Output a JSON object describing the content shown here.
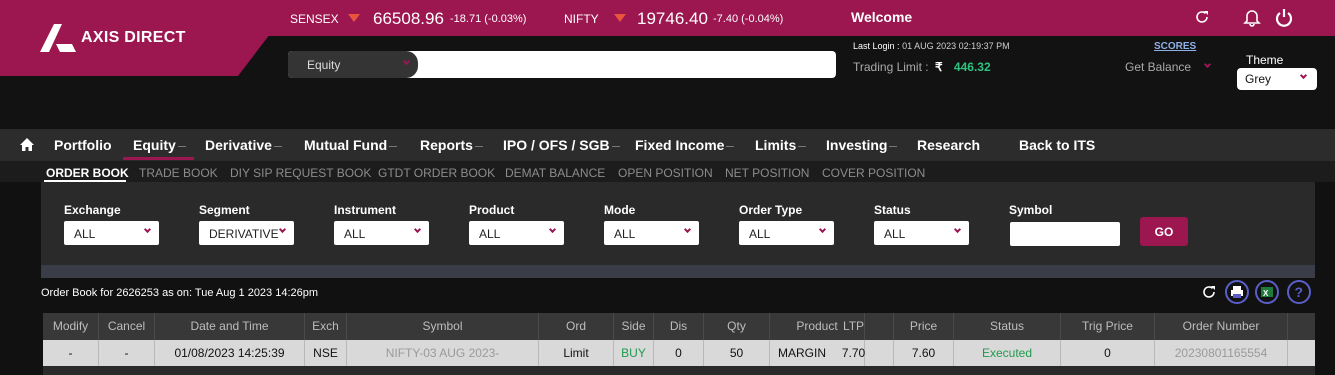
{
  "brand": {
    "name": "AXIS DIRECT",
    "color": "#9c1650"
  },
  "ticker": {
    "sensex": {
      "name": "SENSEX",
      "value": "66508.96",
      "change": "-18.71 (-0.03%)",
      "direction": "down"
    },
    "nifty": {
      "name": "NIFTY",
      "value": "19746.40",
      "change": "-7.40 (-0.04%)",
      "direction": "down"
    }
  },
  "welcome": {
    "title": "Welcome"
  },
  "search": {
    "segment": "Equity",
    "placeholder": ""
  },
  "account": {
    "last_login_label": "Last Login :",
    "last_login_value": "01 AUG 2023 02:19:37 PM",
    "trading_limit_label": "Trading Limit :",
    "currency_symbol": "₹",
    "trading_limit_value": "446.32",
    "scores_label": "SCORES",
    "get_balance_label": "Get Balance",
    "theme_label": "Theme",
    "theme_value": "Grey"
  },
  "nav": {
    "items": [
      {
        "label": "Portfolio",
        "dropdown": false
      },
      {
        "label": "Equity",
        "dropdown": true,
        "active": true
      },
      {
        "label": "Derivative",
        "dropdown": true
      },
      {
        "label": "Mutual Fund",
        "dropdown": true
      },
      {
        "label": "Reports",
        "dropdown": true
      },
      {
        "label": "IPO / OFS / SGB",
        "dropdown": true
      },
      {
        "label": "Fixed Income",
        "dropdown": true
      },
      {
        "label": "Limits",
        "dropdown": true
      },
      {
        "label": "Investing",
        "dropdown": true
      },
      {
        "label": "Research",
        "dropdown": false
      },
      {
        "label": "Back to ITS",
        "dropdown": false
      }
    ]
  },
  "subnav": {
    "tabs": [
      {
        "label": "ORDER BOOK",
        "active": true
      },
      {
        "label": "TRADE BOOK"
      },
      {
        "label": "DIY SIP REQUEST BOOK"
      },
      {
        "label": "GTDT ORDER BOOK"
      },
      {
        "label": "DEMAT BALANCE"
      },
      {
        "label": "OPEN POSITION"
      },
      {
        "label": "NET POSITION"
      },
      {
        "label": "COVER POSITION"
      }
    ]
  },
  "filters": {
    "exchange": {
      "label": "Exchange",
      "value": "ALL"
    },
    "segment": {
      "label": "Segment",
      "value": "DERIVATIVE"
    },
    "instrument": {
      "label": "Instrument",
      "value": "ALL"
    },
    "product": {
      "label": "Product",
      "value": "ALL"
    },
    "mode": {
      "label": "Mode",
      "value": "ALL"
    },
    "order_type": {
      "label": "Order Type",
      "value": "ALL"
    },
    "status": {
      "label": "Status",
      "value": "ALL"
    },
    "symbol": {
      "label": "Symbol",
      "value": ""
    },
    "go_label": "GO"
  },
  "orderbook": {
    "caption": "Order Book for 2626253 as on: Tue Aug 1 2023 14:26pm",
    "columns": [
      "Modify",
      "Cancel",
      "Date and Time",
      "Exch",
      "Symbol",
      "Ord",
      "Side",
      "Dis",
      "Qty",
      "Product",
      "LTP",
      "Price",
      "Status",
      "Trig Price",
      "Order Number"
    ],
    "rows": [
      [
        "-",
        "-",
        "01/08/2023 14:25:39",
        "NSE",
        "NIFTY-03 AUG 2023-",
        "Limit",
        "BUY",
        "0",
        "50",
        "MARGIN",
        "7.70",
        "7.60",
        "Executed",
        "0",
        "20230801165554"
      ]
    ]
  }
}
